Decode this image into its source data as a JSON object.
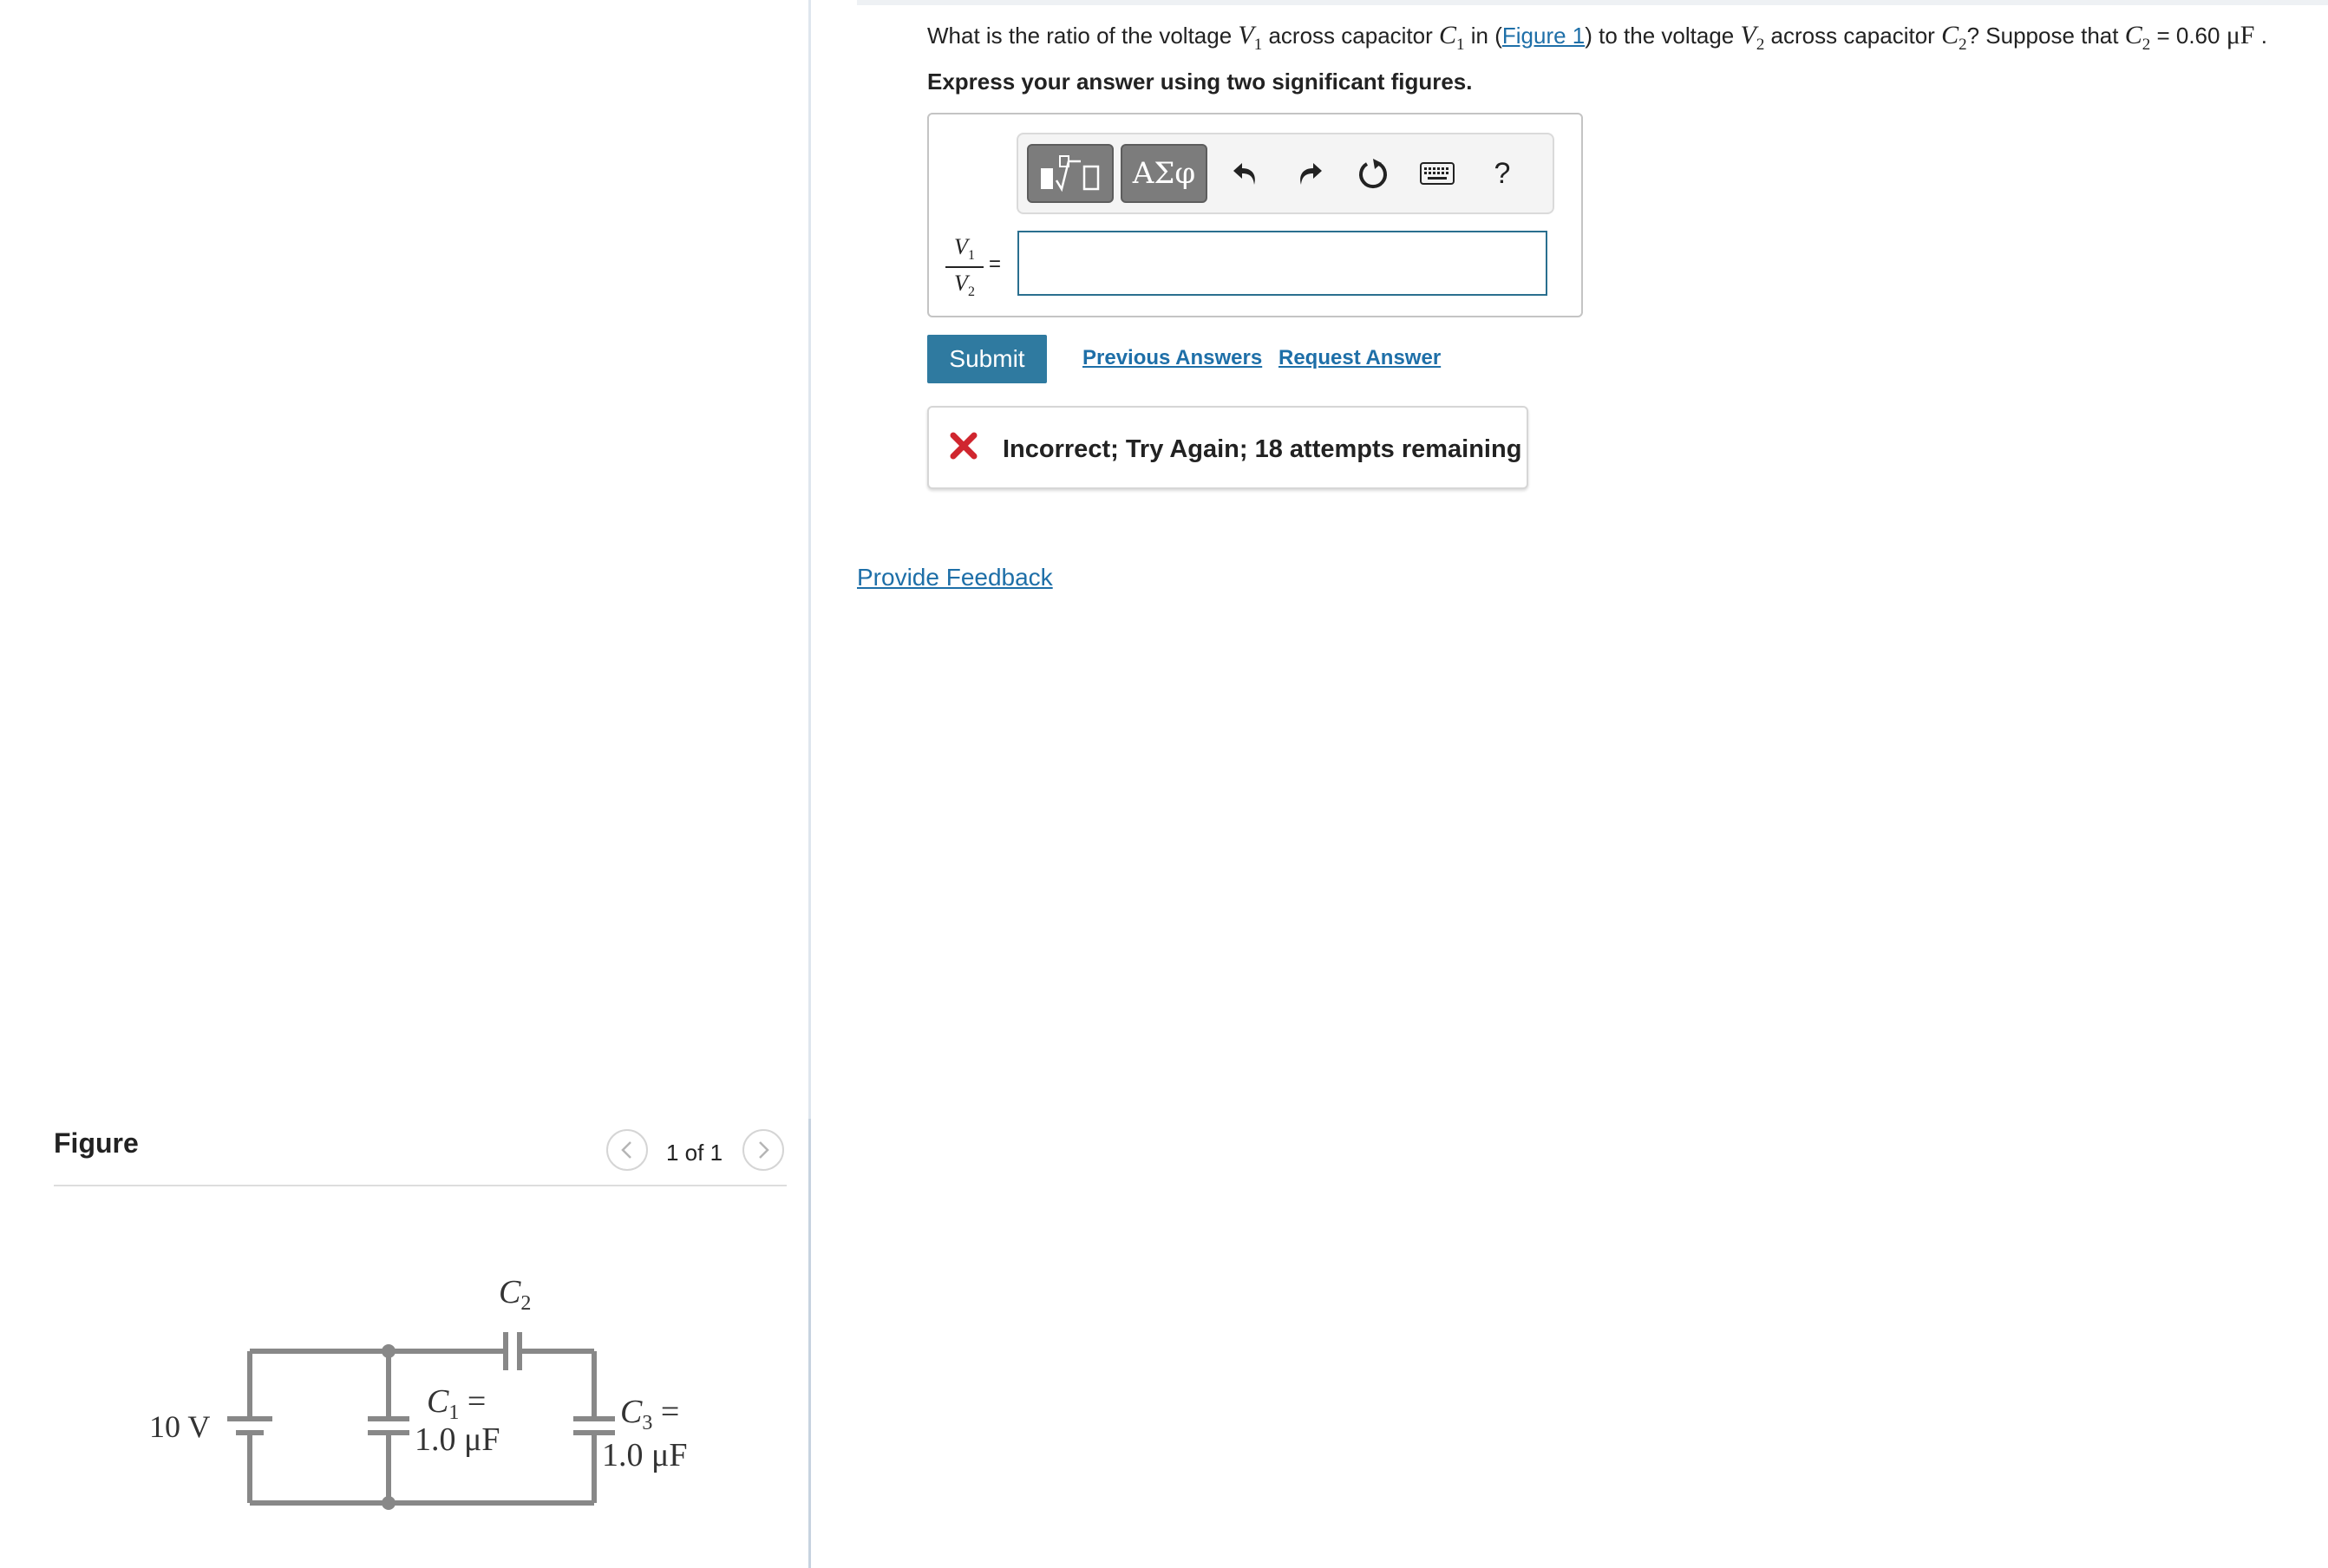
{
  "question": {
    "part1": "What is the ratio of the voltage ",
    "v1": "V",
    "v1_sub": "1",
    "part2": " across capacitor ",
    "c1": "C",
    "c1_sub": "1",
    "part3": " in (",
    "figure_link": "Figure 1",
    "part4": ") to the voltage ",
    "v2": "V",
    "v2_sub": "2",
    "part5": " across capacitor ",
    "c2": "C",
    "c2_sub": "2",
    "part6": "? Suppose that ",
    "c2b": "C",
    "c2b_sub": "2",
    "part7": " = 0.60 ",
    "unit": "μF",
    "part8": " ."
  },
  "instruction": "Express your answer using two significant figures.",
  "toolbar": {
    "greek_label": "ΑΣφ",
    "undo_icon": "undo-icon",
    "redo_icon": "redo-icon",
    "reset_icon": "reset-icon",
    "keyboard_icon": "keyboard-icon",
    "help_label": "?"
  },
  "answer": {
    "numerator": "V",
    "numerator_sub": "1",
    "denominator": "V",
    "denominator_sub": "2",
    "equals": "=",
    "value": ""
  },
  "actions": {
    "submit_label": "Submit",
    "previous_answers_label": "Previous Answers",
    "request_answer_label": "Request Answer"
  },
  "feedback": {
    "message": "Incorrect; Try Again; 18 attempts remaining",
    "status_color": "#d0262f"
  },
  "provide_feedback_label": "Provide Feedback",
  "figure": {
    "title": "Figure",
    "page_indicator": "1 of 1",
    "battery_label": "10 V",
    "c2_label": "C",
    "c2_sub": "2",
    "c1_label_line1": "C",
    "c1_sub": "1",
    "c1_eq": " =",
    "c1_value": "1.0 μF",
    "c3_label_line1": "C",
    "c3_sub": "3",
    "c3_eq": " =",
    "c3_value": "1.0 μF"
  },
  "colors": {
    "link": "#1e6fa8",
    "submit_bg": "#2f7aa0",
    "input_border": "#2a6f8f",
    "wire": "#888888"
  }
}
